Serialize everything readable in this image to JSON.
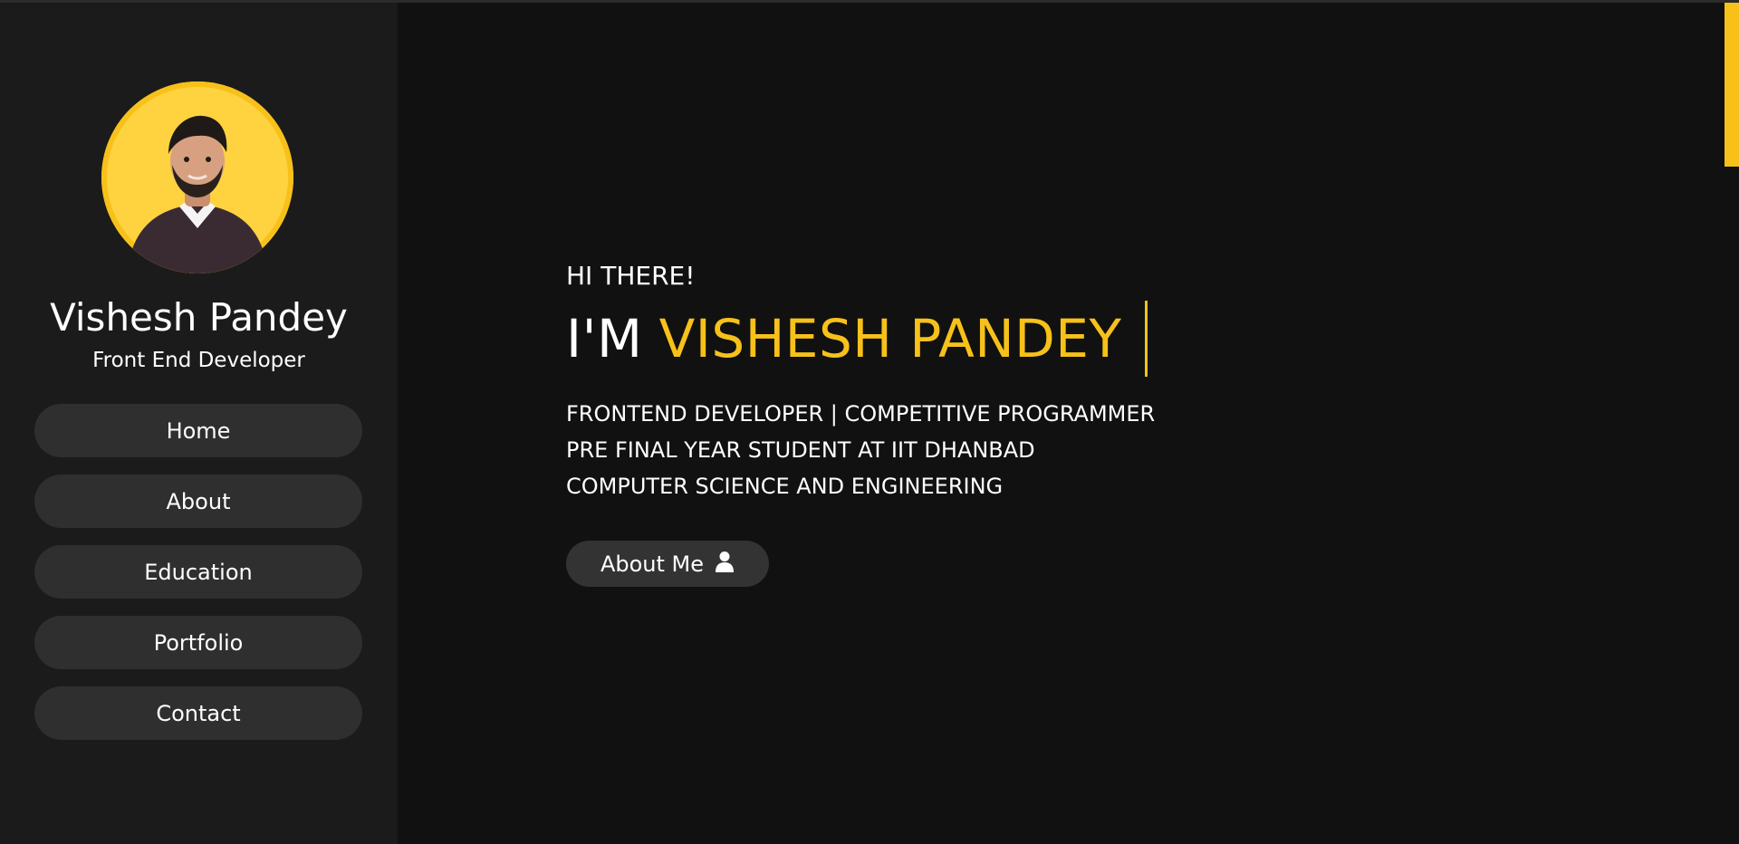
{
  "sidebar": {
    "profile": {
      "name": "Vishesh Pandey",
      "role": "Front End Developer"
    },
    "nav_items": [
      {
        "label": "Home"
      },
      {
        "label": "About"
      },
      {
        "label": "Education"
      },
      {
        "label": "Portfolio"
      },
      {
        "label": "Contact"
      }
    ]
  },
  "hero": {
    "greeting": "HI THERE!",
    "headline_prefix": "I'M",
    "headline_name": "VISHESH PANDEY",
    "subtitles": [
      "FRONTEND DEVELOPER | COMPETITIVE PROGRAMMER",
      "PRE FINAL YEAR STUDENT AT IIT DHANBAD",
      "COMPUTER SCIENCE AND ENGINEERING"
    ],
    "cta_label": "About Me",
    "cta_icon": "user-icon"
  },
  "colors": {
    "accent": "#f7c11a",
    "background": "#111111",
    "sidebar": "#1b1b1b",
    "button": "#2f2f2f",
    "text": "#ffffff"
  }
}
